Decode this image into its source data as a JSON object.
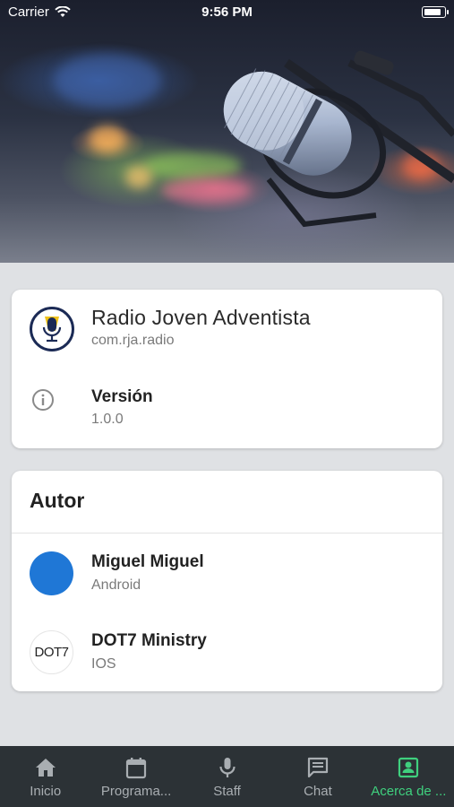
{
  "status_bar": {
    "carrier": "Carrier",
    "time": "9:56 PM"
  },
  "app": {
    "name": "Radio Joven Adventista",
    "package_id": "com.rja.radio",
    "version_label": "Versión",
    "version_value": "1.0.0"
  },
  "author_section": {
    "title": "Autor",
    "people": [
      {
        "name": "Miguel Miguel",
        "role": "Android",
        "avatar_color": "#1f77d6"
      },
      {
        "name": "DOT7 Ministry",
        "role": "IOS",
        "avatar_text": "DOT7"
      }
    ]
  },
  "tabs": [
    {
      "label": "Inicio",
      "icon": "home-icon",
      "active": false
    },
    {
      "label": "Programa...",
      "icon": "calendar-icon",
      "active": false
    },
    {
      "label": "Staff",
      "icon": "microphone-icon",
      "active": false
    },
    {
      "label": "Chat",
      "icon": "chat-icon",
      "active": false
    },
    {
      "label": "Acerca de ...",
      "icon": "contact-card-icon",
      "active": true
    }
  ],
  "colors": {
    "active_tab": "#3fd07e",
    "tab_bar": "#2c3236",
    "page_background": "#dfe1e4"
  }
}
